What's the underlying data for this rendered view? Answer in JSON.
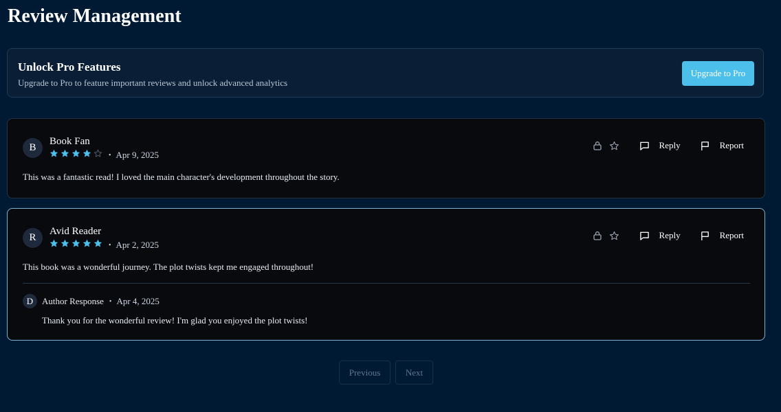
{
  "page": {
    "title": "Review Management"
  },
  "promo": {
    "title": "Unlock Pro Features",
    "description": "Upgrade to Pro to feature important reviews and unlock advanced analytics",
    "button_label": "Upgrade to Pro"
  },
  "colors": {
    "background": "#001a33",
    "card_background": "#090a0e",
    "accent": "#4cc0eb",
    "star_filled": "#4cc0eb",
    "star_empty": "#5a6675",
    "highlight_border": "#7eb3d6"
  },
  "actions": {
    "reply_label": "Reply",
    "report_label": "Report",
    "icons": [
      "lock-icon",
      "star-icon",
      "message-icon",
      "flag-icon"
    ]
  },
  "reviews": [
    {
      "initial": "B",
      "name": "Book Fan",
      "rating": 4,
      "max_rating": 5,
      "separator": "•",
      "date": "Apr 9, 2025",
      "text": "This was a fantastic read! I loved the main character's development throughout the story."
    },
    {
      "initial": "R",
      "name": "Avid Reader",
      "rating": 5,
      "max_rating": 5,
      "separator": "•",
      "date": "Apr 2, 2025",
      "text": "This book was a wonderful journey. The plot twists kept me engaged throughout!",
      "response": {
        "initial": "D",
        "author": "Author Response",
        "separator": "•",
        "date": "Apr 4, 2025",
        "text": "Thank you for the wonderful review! I'm glad you enjoyed the plot twists!"
      }
    }
  ],
  "pagination": {
    "previous_label": "Previous",
    "next_label": "Next"
  }
}
